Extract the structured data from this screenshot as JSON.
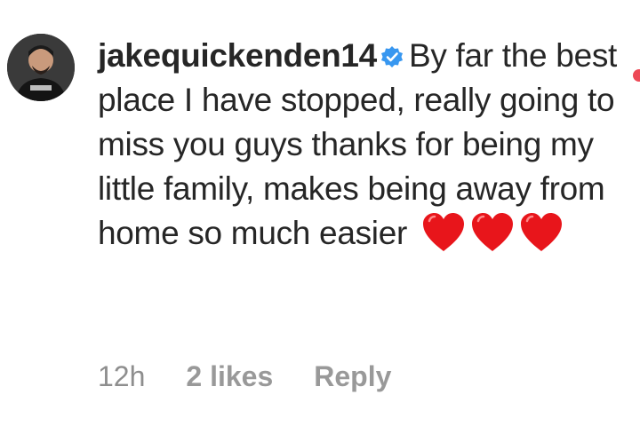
{
  "comment": {
    "username": "jakequickenden14",
    "verified_icon": "verified-badge-icon",
    "text": "By far the best place I have stopped, really going to miss you guys thanks for being my little family, makes being away from home so much easier",
    "emoji": [
      "heart-icon",
      "heart-icon",
      "heart-icon"
    ],
    "timestamp": "12h",
    "likes": "2 likes",
    "reply_label": "Reply"
  },
  "colors": {
    "text": "#262626",
    "meta": "#8e8e8e",
    "verified": "#3897f0",
    "heart": "#e8151b",
    "like_dot": "#ed4956"
  }
}
